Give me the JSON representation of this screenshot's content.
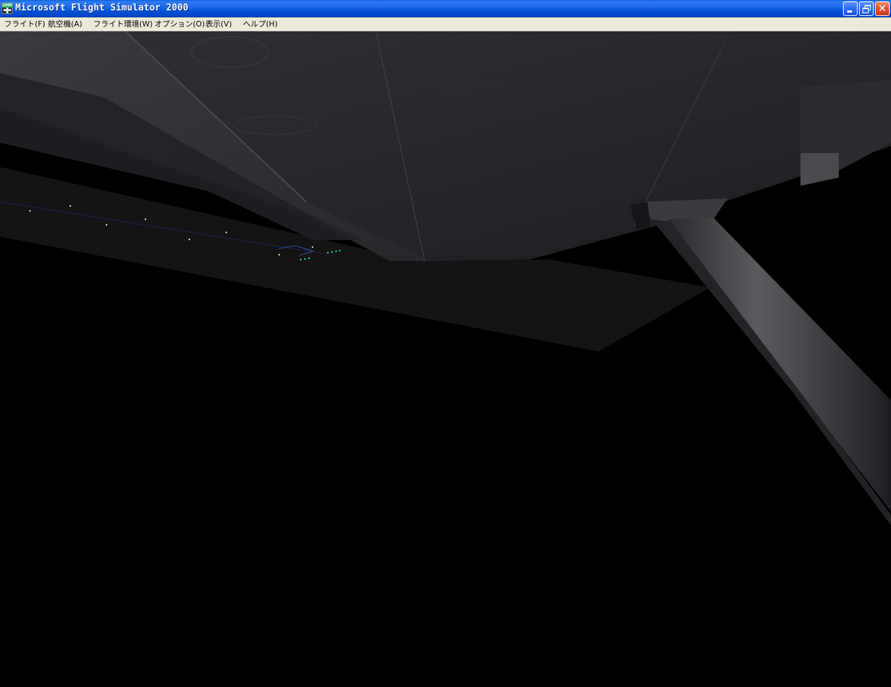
{
  "window": {
    "title": "Microsoft Flight Simulator 2000",
    "icon": "fs2000-app-icon",
    "icon_badge": "2000",
    "controls": {
      "minimize": "minimize-icon",
      "maximize": "restore-icon",
      "close": "close-icon"
    }
  },
  "menu": {
    "items": [
      {
        "label": "フライト(F)"
      },
      {
        "label": "航空機(A)"
      },
      {
        "label": "フライト環境(W)"
      },
      {
        "label": "オプション(O)"
      },
      {
        "label": "表示(V)"
      },
      {
        "label": "ヘルプ(H)"
      }
    ]
  },
  "viewport": {
    "scene": "night view under aircraft wing with runway lights",
    "colors": {
      "background": "#000000",
      "wing": "#2a2b30",
      "strut": "#4a4a50",
      "runway_light_white": "#e8e0b0",
      "runway_light_green": "#2ee08a"
    }
  }
}
